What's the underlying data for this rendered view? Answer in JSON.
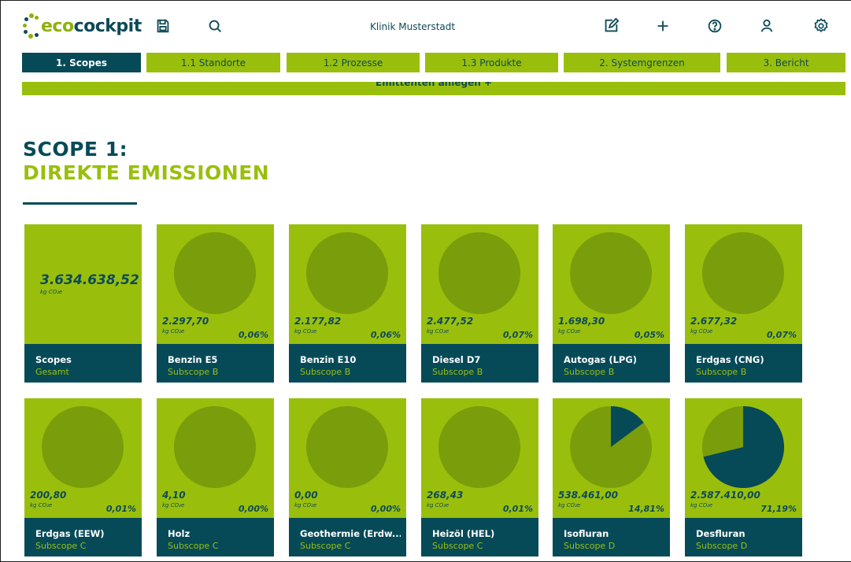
{
  "app": {
    "logo_eco": "eco",
    "logo_rest": "cockpit",
    "clinic": "Klinik Musterstadt"
  },
  "icons": {
    "save": "save-icon",
    "search": "search-icon",
    "edit": "edit-icon",
    "add": "plus-icon",
    "help": "help-icon",
    "user": "user-icon",
    "settings": "gear-icon"
  },
  "tabs": [
    {
      "label": "1. Scopes",
      "active": true
    },
    {
      "label": "1.1 Standorte",
      "active": false
    },
    {
      "label": "1.2 Prozesse",
      "active": false
    },
    {
      "label": "1.3 Produkte",
      "active": false
    },
    {
      "label": "2. Systemgrenzen",
      "active": false
    },
    {
      "label": "3. Bericht",
      "active": false
    }
  ],
  "emit_band": {
    "label": "Emittenten anlegen   +"
  },
  "heading": {
    "line1": "SCOPE 1:",
    "line2": "DIREKTE EMISSIONEN"
  },
  "unit": "kg CO₂e",
  "colors": {
    "green": "#99bf0c",
    "teal": "#064a58",
    "pie_rest": "#7a9d0b"
  },
  "total_card": {
    "value": "3.634.638,52",
    "unit": "kg CO₂e",
    "name": "Scopes",
    "sub": "Gesamt"
  },
  "cards": [
    {
      "value": "2.297,70",
      "pct": "0,06%",
      "share": 0.0006,
      "name": "Benzin E5",
      "sub": "Subscope B"
    },
    {
      "value": "2.177,82",
      "pct": "0,06%",
      "share": 0.0006,
      "name": "Benzin E10",
      "sub": "Subscope B"
    },
    {
      "value": "2.477,52",
      "pct": "0,07%",
      "share": 0.0007,
      "name": "Diesel D7",
      "sub": "Subscope B"
    },
    {
      "value": "1.698,30",
      "pct": "0,05%",
      "share": 0.0005,
      "name": "Autogas (LPG)",
      "sub": "Subscope B"
    },
    {
      "value": "2.677,32",
      "pct": "0,07%",
      "share": 0.0007,
      "name": "Erdgas (CNG)",
      "sub": "Subscope B"
    },
    {
      "value": "200,80",
      "pct": "0,01%",
      "share": 0.0001,
      "name": "Erdgas (EEW)",
      "sub": "Subscope C"
    },
    {
      "value": "4,10",
      "pct": "0,00%",
      "share": 0.0,
      "name": "Holz",
      "sub": "Subscope C"
    },
    {
      "value": "0,00",
      "pct": "0,00%",
      "share": 0.0,
      "name": "Geothermie (Erdw...",
      "sub": "Subscope C"
    },
    {
      "value": "268,43",
      "pct": "0,01%",
      "share": 0.0001,
      "name": "Heizöl (HEL)",
      "sub": "Subscope C"
    },
    {
      "value": "538.461,00",
      "pct": "14,81%",
      "share": 0.1481,
      "name": "Isofluran",
      "sub": "Subscope D"
    },
    {
      "value": "2.587.410,00",
      "pct": "71,19%",
      "share": 0.7119,
      "name": "Desfluran",
      "sub": "Subscope D"
    }
  ]
}
